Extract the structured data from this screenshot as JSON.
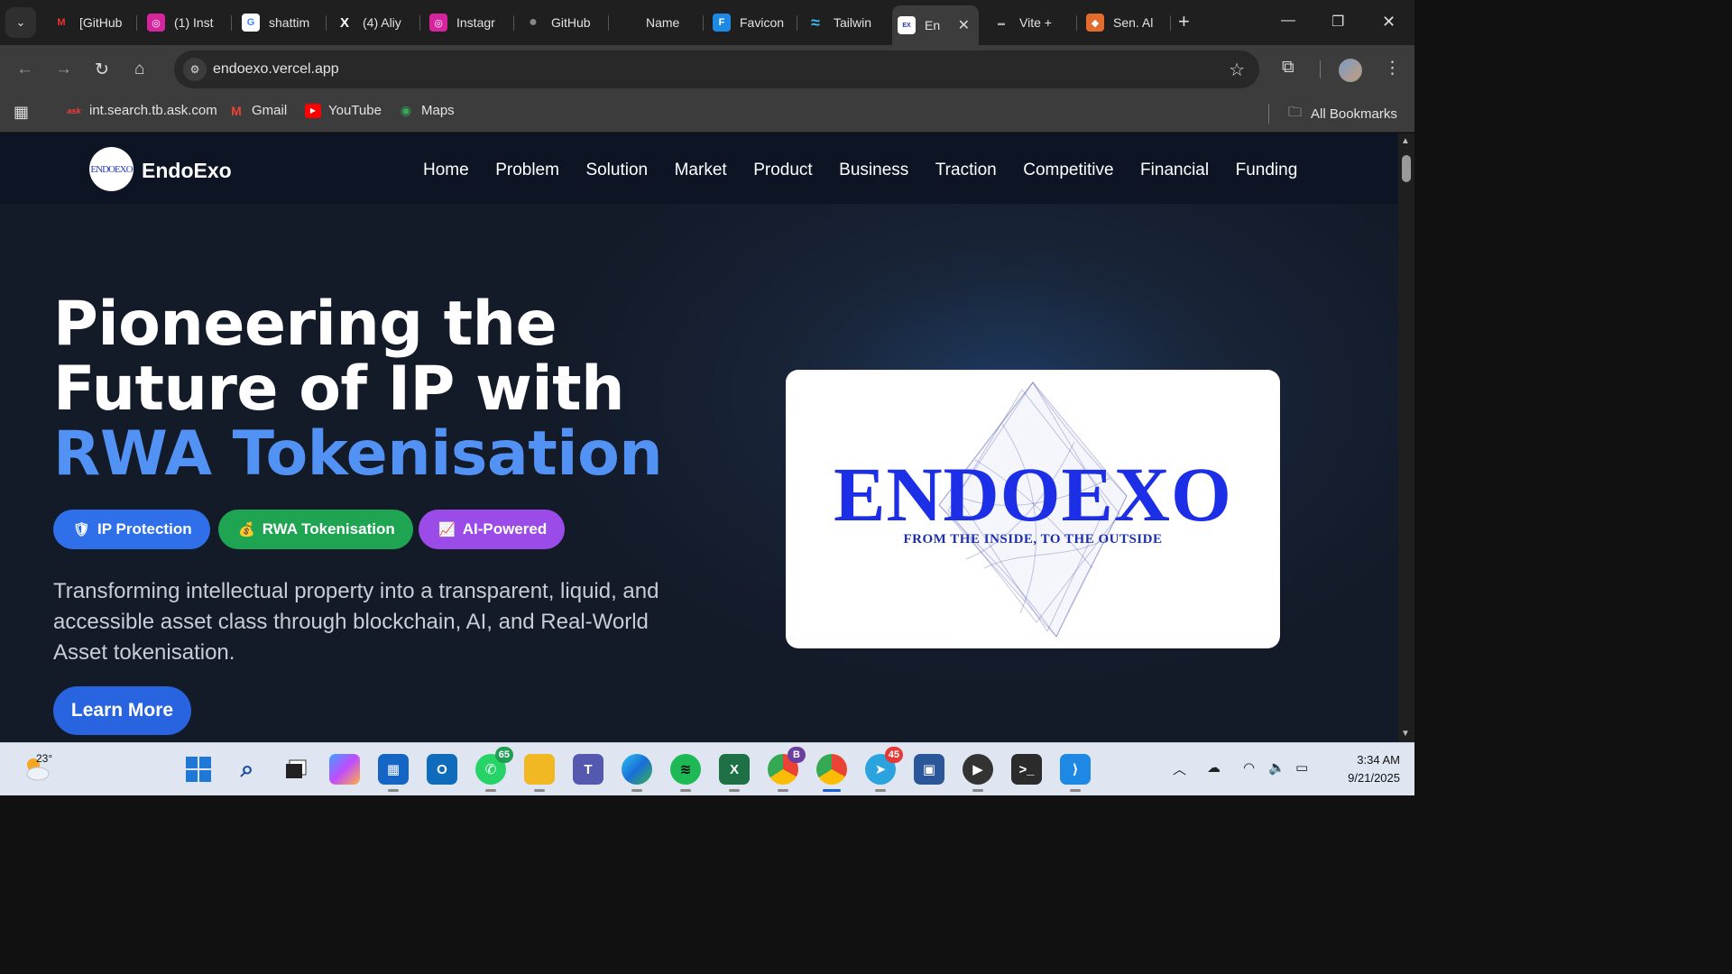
{
  "browser": {
    "tabs": [
      {
        "label": "[GitHub",
        "fav_color": "#ffffff",
        "fav_text": "M",
        "fav_fg": "#e33"
      },
      {
        "label": "(1) Inst",
        "fav_color": "#d6249f",
        "fav_text": "◎",
        "fav_fg": "#fff"
      },
      {
        "label": "shattim",
        "fav_color": "#ffffff",
        "fav_text": "G",
        "fav_fg": "#4285f4"
      },
      {
        "label": "(4) Aliy",
        "fav_color": "#1f1f1f",
        "fav_text": "X",
        "fav_fg": "#fff"
      },
      {
        "label": "Instagr",
        "fav_color": "#d6249f",
        "fav_text": "◎",
        "fav_fg": "#fff"
      },
      {
        "label": "GitHub",
        "fav_color": "#1f1f1f",
        "fav_text": "●",
        "fav_fg": "#888"
      },
      {
        "label": "Name",
        "fav_color": "#1f1f1f",
        "fav_text": "",
        "fav_fg": "#fff"
      },
      {
        "label": "Favicon",
        "fav_color": "#1e88e5",
        "fav_text": "F",
        "fav_fg": "#fff"
      },
      {
        "label": "Tailwin",
        "fav_color": "#1f1f1f",
        "fav_text": "≈",
        "fav_fg": "#38bdf8"
      },
      {
        "label": "En",
        "fav_color": "#ffffff",
        "fav_text": "EX",
        "fav_fg": "#2538b8"
      },
      {
        "label": "Vite +",
        "fav_color": "#1f1f1f",
        "fav_text": "▬",
        "fav_fg": "#aaa"
      },
      {
        "label": "Sen. Al",
        "fav_color": "#e36b2b",
        "fav_text": "◆",
        "fav_fg": "#fff"
      }
    ],
    "url": "endoexo.vercel.app",
    "bookmarks": [
      {
        "label": "int.search.tb.ask.com",
        "fav_color": "#cc0000",
        "fav_text": "ask"
      },
      {
        "label": "Gmail",
        "fav_color": "#ffffff",
        "fav_text": "M"
      },
      {
        "label": "YouTube",
        "fav_color": "#ff0000",
        "fav_text": "▶"
      },
      {
        "label": "Maps",
        "fav_color": "#34a853",
        "fav_text": "◉"
      }
    ],
    "all_bookmarks": "All Bookmarks"
  },
  "site": {
    "logo_text": "ENDOEXO",
    "brand": "EndoExo",
    "nav": [
      "Home",
      "Problem",
      "Solution",
      "Market",
      "Product",
      "Business",
      "Traction",
      "Competitive",
      "Financial",
      "Funding"
    ],
    "hero": {
      "line1": "Pioneering the",
      "line2": "Future of IP with",
      "line3": "RWA Tokenisation"
    },
    "pills": [
      {
        "icon": "🛡",
        "label": "IP Protection",
        "color": "#2f6fea"
      },
      {
        "icon": "💰",
        "label": "RWA Tokenisation",
        "color": "#1fa552"
      },
      {
        "icon": "📈",
        "label": "AI-Powered",
        "color": "#9b4be8"
      }
    ],
    "description": "Transforming intellectual property into a transparent, liquid, and accessible asset class through blockchain, AI, and Real-World Asset tokenisation.",
    "cta": "Learn More",
    "card": {
      "wordmark": "ENDOEXO",
      "tagline": "FROM THE INSIDE, TO THE OUTSIDE"
    }
  },
  "taskbar": {
    "temperature": "23°",
    "whatsapp_badge": "65",
    "chrome_badge": "B",
    "telegram_badge": "45",
    "time": "3:34 AM",
    "date": "9/21/2025"
  }
}
